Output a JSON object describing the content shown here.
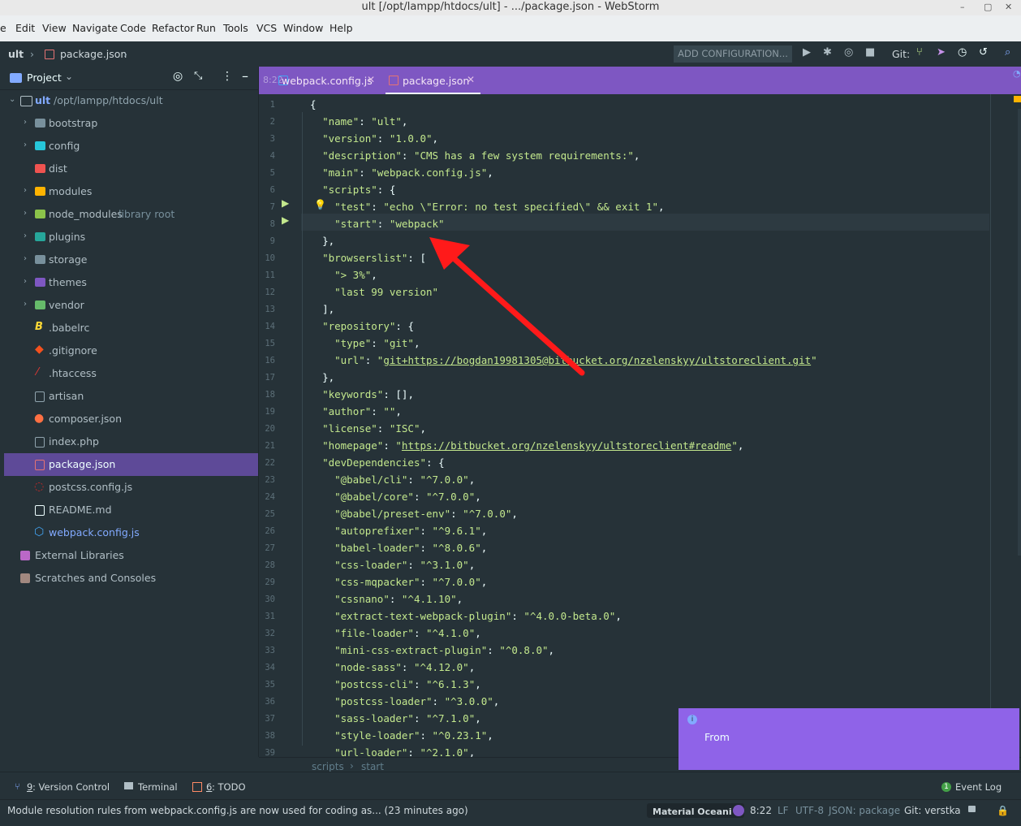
{
  "window": {
    "title": "ult [/opt/lampp/htdocs/ult] - .../package.json - WebStorm"
  },
  "menu": [
    "e",
    "Edit",
    "View",
    "Navigate",
    "Code",
    "Refactor",
    "Run",
    "Tools",
    "VCS",
    "Window",
    "Help"
  ],
  "navbar": {
    "project": "ult",
    "file": "package.json",
    "run_config": "ADD CONFIGURATION...",
    "git_label": "Git:"
  },
  "sidebar": {
    "title": "Project",
    "root": {
      "name": "ult",
      "path": "/opt/lampp/htdocs/ult"
    },
    "items": [
      {
        "label": "bootstrap",
        "color": "#b0bec5"
      },
      {
        "label": "config",
        "color": "#b0bec5"
      },
      {
        "label": "dist",
        "color": "#b0bec5"
      },
      {
        "label": "modules",
        "color": "#b0bec5"
      },
      {
        "label": "node_modules",
        "extra": "library root",
        "color": "#b0bec5"
      },
      {
        "label": "plugins",
        "color": "#b0bec5"
      },
      {
        "label": "storage",
        "color": "#b0bec5"
      },
      {
        "label": "themes",
        "color": "#b0bec5"
      },
      {
        "label": "vendor",
        "color": "#b0bec5"
      },
      {
        "label": ".babelrc",
        "color": "#b0bec5"
      },
      {
        "label": ".gitignore",
        "color": "#b0bec5"
      },
      {
        "label": ".htaccess",
        "color": "#b0bec5"
      },
      {
        "label": "artisan",
        "color": "#b0bec5"
      },
      {
        "label": "composer.json",
        "color": "#b0bec5"
      },
      {
        "label": "index.php",
        "color": "#b0bec5"
      },
      {
        "label": "package.json",
        "color": "#eeffff"
      },
      {
        "label": "postcss.config.js",
        "color": "#b0bec5"
      },
      {
        "label": "README.md",
        "color": "#b0bec5"
      },
      {
        "label": "webpack.config.js",
        "color": "#82aaff"
      }
    ],
    "external": "External Libraries",
    "scratches": "Scratches and Consoles"
  },
  "tabs": [
    {
      "label": "webpack.config.js",
      "overlay": "8:22"
    },
    {
      "label": "package.json"
    }
  ],
  "code": {
    "lines": [
      "{",
      "  \"name\": \"ult\",",
      "  \"version\": \"1.0.0\",",
      "  \"description\": \"CMS has a few system requirements:\",",
      "  \"main\": \"webpack.config.js\",",
      "  \"scripts\": {",
      "    \"test\": \"echo \\\"Error: no test specified\\\" && exit 1\",",
      "    \"start\": \"webpack\"",
      "  },",
      "  \"browserslist\": [",
      "    \"> 3%\",",
      "    \"last 99 version\"",
      "  ],",
      "  \"repository\": {",
      "    \"type\": \"git\",",
      "    \"url\": \"git+https://bogdan19981305@bitbucket.org/nzelenskyy/ultstoreclient.git\"",
      "  },",
      "  \"keywords\": [],",
      "  \"author\": \"\",",
      "  \"license\": \"ISC\",",
      "  \"homepage\": \"https://bitbucket.org/nzelenskyy/ultstoreclient#readme\",",
      "  \"devDependencies\": {",
      "    \"@babel/cli\": \"^7.0.0\",",
      "    \"@babel/core\": \"^7.0.0\",",
      "    \"@babel/preset-env\": \"^7.0.0\",",
      "    \"autoprefixer\": \"^9.6.1\",",
      "    \"babel-loader\": \"^8.0.6\",",
      "    \"css-loader\": \"^3.1.0\",",
      "    \"css-mqpacker\": \"^7.0.0\",",
      "    \"cssnano\": \"^4.1.10\",",
      "    \"extract-text-webpack-plugin\": \"^4.0.0-beta.0\",",
      "    \"file-loader\": \"^4.1.0\",",
      "    \"mini-css-extract-plugin\": \"^0.8.0\",",
      "    \"node-sass\": \"^4.12.0\",",
      "    \"postcss-cli\": \"^6.1.3\",",
      "    \"postcss-loader\": \"^3.0.0\",",
      "    \"sass-loader\": \"^7.1.0\",",
      "    \"style-loader\": \"^0.23.1\",",
      "    \"url-loader\": \"^2.1.0\","
    ]
  },
  "breadcrumb": [
    "scripts",
    "start"
  ],
  "bottom_tools": [
    {
      "key": "9",
      "label": ": Version Control"
    },
    {
      "label": "Terminal"
    },
    {
      "key": "6",
      "label": ": TODO"
    }
  ],
  "event_log": {
    "badge": "1",
    "label": "Event Log"
  },
  "status": {
    "message": "Module resolution rules from webpack.config.js are now used for coding as... (23 minutes ago)",
    "theme": "Material Oceani",
    "position": "8:22",
    "line_sep": "LF",
    "encoding": "UTF-8",
    "schema": "JSON: package",
    "git": "Git: verstka"
  },
  "toast": {
    "text": "From"
  },
  "colors": {
    "accent": "#7e57c2",
    "selection": "#5e4a98",
    "toast": "#8f63e8",
    "arrow": "#ff1a1a"
  }
}
